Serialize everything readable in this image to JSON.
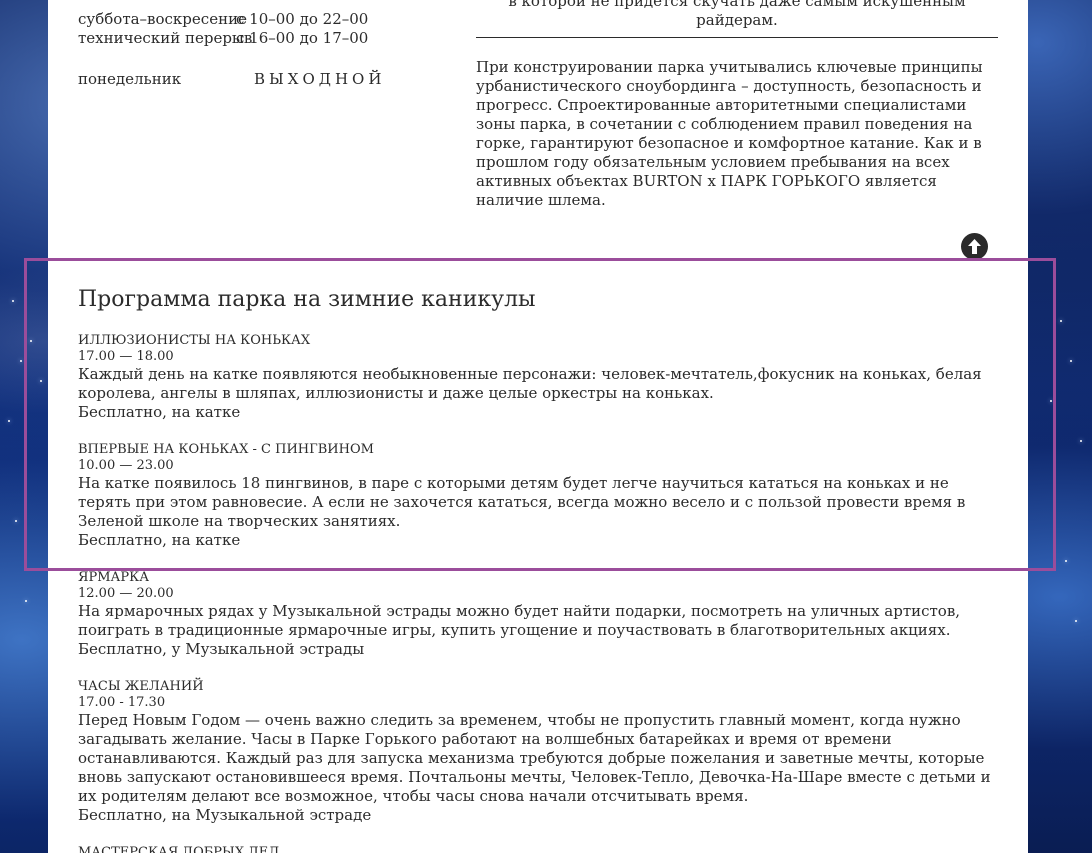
{
  "schedule": {
    "rows": [
      {
        "label": "суббота–воскресение",
        "value": "с 10–00 до 22–00"
      },
      {
        "label": "технический перерыв",
        "value": "с 16–00 до 17–00"
      }
    ],
    "closed": {
      "label": "понедельник",
      "value": "ВЫХОДНОЙ"
    }
  },
  "intro": {
    "top_cut": "в которой не придется скучать даже самым искушенным райдерам.",
    "paragraph": "При конструировании парка учитывались ключевые принципы урбанистического сноубординга – доступность, безопасность и прогресс. Спроектированные авторитетными специалистами зоны парка, в сочетании с соблюдением правил поведения на горке, гарантируют безопасное и комфортное катание. Как и в прошлом году обязательным условием пребывания на всех активных объектах BURTON x ПАРК ГОРЬКОГО является наличие шлема."
  },
  "program": {
    "title": "Программа парка на зимние каникулы",
    "events": [
      {
        "title": "ИЛЛЮЗИОНИСТЫ НА КОНЬКАХ",
        "time": "17.00 — 18.00",
        "description": "Каждый день на катке появляются необыкновенные персонажи: человек-мечтатель,фокусник на коньках, белая королева, ангелы в шляпах, иллюзионисты и даже целые оркестры на коньках.",
        "place": "Бесплатно, на катке"
      },
      {
        "title": "ВПЕРВЫЕ НА КОНЬКАХ - С ПИНГВИНОМ",
        "time": "10.00 — 23.00",
        "description": "На катке появилось 18 пингвинов, в паре с которыми детям будет легче научиться кататься на коньках и не терять при этом равновесие. А если не захочется кататься, всегда можно весело и с пользой провести время в Зеленой школе на творческих занятиях.",
        "place": "Бесплатно, на катке"
      },
      {
        "title": "ЯРМАРКА",
        "time": "12.00 — 20.00",
        "description": "На ярмарочных рядах у Музыкальной эстрады можно будет найти подарки, посмотреть на уличных артистов, поиграть в традиционные ярмарочные игры, купить угощение и поучаствовать в благотворительных акциях.",
        "place": "Бесплатно, у Музыкальной эстрады"
      },
      {
        "title": "ЧАСЫ ЖЕЛАНИЙ",
        "time": "17.00 - 17.30",
        "description": "Перед Новым Годом — очень важно следить за временем, чтобы не пропустить главный момент, когда нужно загадывать желание. Часы в Парке Горького работают на волшебных батарейках и время от времени останавливаются. Каждый раз для запуска механизма требуются добрые пожелания и заветные мечты, которые вновь запускают остановившееся время. Почтальоны мечты, Человек-Тепло, Девочка-На-Шаре вместе с детьми и их родителям делают все возможное, чтобы часы снова начали отсчитывать время.",
        "place": "Бесплатно, на Музыкальной эстраде"
      },
      {
        "title": "МАСТЕРСКАЯ ДОБРЫХ ДЕЛ",
        "time": "",
        "description": "",
        "place": ""
      }
    ]
  },
  "ui": {
    "scroll_top_icon": "arrow-up-icon",
    "highlight_color": "#9b4d9b"
  }
}
